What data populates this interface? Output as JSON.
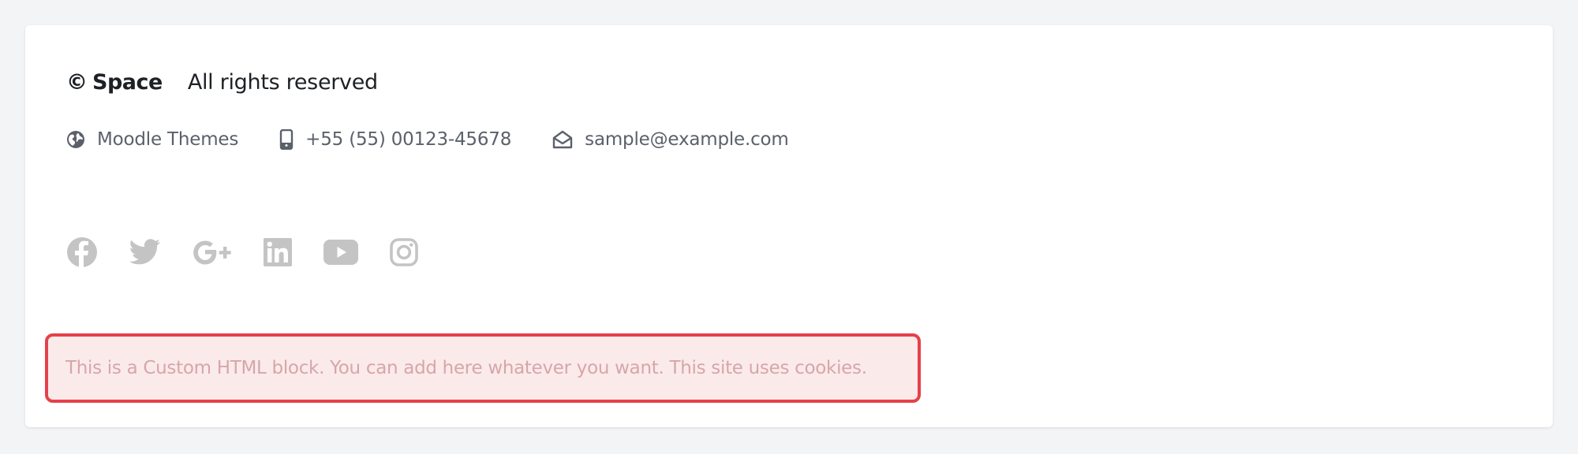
{
  "footer": {
    "copyright_symbol": "©",
    "brand": "Space",
    "rights": "All rights reserved",
    "contacts": [
      {
        "icon": "globe-icon",
        "text": "Moodle Themes"
      },
      {
        "icon": "mobile-phone-icon",
        "text": "+55 (55) 00123-45678"
      },
      {
        "icon": "envelope-open-icon",
        "text": "sample@example.com"
      }
    ],
    "social_icons": [
      "facebook-icon",
      "twitter-icon",
      "google-plus-icon",
      "linkedin-icon",
      "youtube-icon",
      "instagram-icon"
    ],
    "custom_html_block": {
      "text": "This is a Custom HTML block. You can add here whatever you want. This site uses cookies."
    }
  },
  "colors": {
    "page_background": "#f3f4f6",
    "card_background": "#ffffff",
    "primary_text": "#1d2125",
    "secondary_text": "#5b606b",
    "social_icon": "#c4c4c4",
    "alert_border": "#e5414a",
    "alert_background": "#fbeaea",
    "alert_text": "#d6a6aa"
  }
}
